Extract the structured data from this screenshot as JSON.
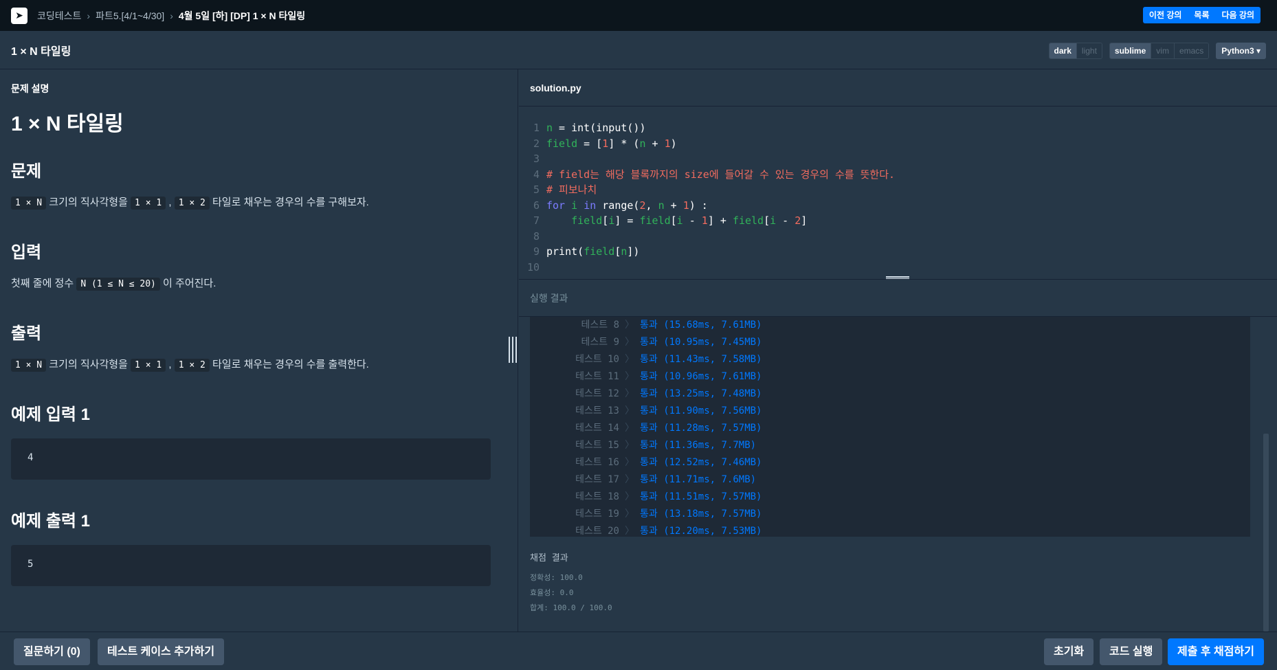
{
  "topbar": {
    "breadcrumb": [
      "코딩테스트",
      "파트5.[4/1~4/30]"
    ],
    "current": "4월 5일 [하] [DP] 1 × N 타일링",
    "nav": [
      "이전 강의",
      "목록",
      "다음 강의"
    ]
  },
  "subbar": {
    "title": "1 × N 타일링",
    "theme": [
      "dark",
      "light"
    ],
    "keymap": [
      "sublime",
      "vim",
      "emacs"
    ],
    "language": "Python3 ▾"
  },
  "problem": {
    "label": "문제 설명",
    "title": "1 × N 타일링",
    "sections": {
      "q_title": "문제",
      "q_code1": "1 × N",
      "q_text1": " 크기의 직사각형을 ",
      "q_code2": "1 × 1",
      "q_comma": " , ",
      "q_code3": "1 × 2",
      "q_text2": " 타일로 채우는 경우의 수를 구해보자.",
      "in_title": "입력",
      "in_text1": "첫째 줄에 정수 ",
      "in_code": "N (1 ≤ N ≤ 20)",
      "in_text2": " 이 주어진다.",
      "out_title": "출력",
      "out_code1": "1 × N",
      "out_text1": " 크기의 직사각형을 ",
      "out_code2": "1 × 1",
      "out_comma": " , ",
      "out_code3": "1 × 2",
      "out_text2": " 타일로 채우는 경우의 수를 출력한다.",
      "sin_title": "예제 입력 1",
      "sin_value": "4",
      "sout_title": "예제 출력 1",
      "sout_value": "5"
    }
  },
  "editor": {
    "filename": "solution.py",
    "lines": [
      {
        "n": "1",
        "segs": [
          [
            "n",
            "#31b35a"
          ],
          [
            " = int(input())",
            "#ffffff"
          ]
        ]
      },
      {
        "n": "2",
        "segs": [
          [
            "field",
            "#31b35a"
          ],
          [
            " = [",
            "#ffffff"
          ],
          [
            "1",
            "#f36c5f"
          ],
          [
            "] * (",
            "#ffffff"
          ],
          [
            "n",
            "#31b35a"
          ],
          [
            " + ",
            "#ffffff"
          ],
          [
            "1",
            "#f36c5f"
          ],
          [
            ")",
            "#ffffff"
          ]
        ]
      },
      {
        "n": "3",
        "segs": []
      },
      {
        "n": "4",
        "segs": [
          [
            "# ",
            "#f36c5f"
          ],
          [
            "field",
            "#f36c5f"
          ],
          [
            "는 해당 블록까지의 ",
            "#f36c5f"
          ],
          [
            "size",
            "#f36c5f"
          ],
          [
            "에 들어갈 수 있는 경우의 수를 뜻한다.",
            "#f36c5f"
          ]
        ]
      },
      {
        "n": "5",
        "segs": [
          [
            "# 피보나치",
            "#f36c5f"
          ]
        ]
      },
      {
        "n": "6",
        "segs": [
          [
            "for",
            "#7c7cff"
          ],
          [
            " ",
            "#ffffff"
          ],
          [
            "i",
            "#31b35a"
          ],
          [
            " ",
            "#ffffff"
          ],
          [
            "in",
            "#7c7cff"
          ],
          [
            " range(",
            "#ffffff"
          ],
          [
            "2",
            "#f36c5f"
          ],
          [
            ", ",
            "#ffffff"
          ],
          [
            "n",
            "#31b35a"
          ],
          [
            " + ",
            "#ffffff"
          ],
          [
            "1",
            "#f36c5f"
          ],
          [
            ") :",
            "#ffffff"
          ]
        ]
      },
      {
        "n": "7",
        "segs": [
          [
            "    field",
            "#31b35a"
          ],
          [
            "[",
            "#ffffff"
          ],
          [
            "i",
            "#31b35a"
          ],
          [
            "] = ",
            "#ffffff"
          ],
          [
            "field",
            "#31b35a"
          ],
          [
            "[",
            "#ffffff"
          ],
          [
            "i",
            "#31b35a"
          ],
          [
            " - ",
            "#ffffff"
          ],
          [
            "1",
            "#f36c5f"
          ],
          [
            "] + ",
            "#ffffff"
          ],
          [
            "field",
            "#31b35a"
          ],
          [
            "[",
            "#ffffff"
          ],
          [
            "i",
            "#31b35a"
          ],
          [
            " - ",
            "#ffffff"
          ],
          [
            "2",
            "#f36c5f"
          ],
          [
            "]",
            "#ffffff"
          ]
        ]
      },
      {
        "n": "8",
        "segs": []
      },
      {
        "n": "9",
        "segs": [
          [
            "print(",
            "#ffffff"
          ],
          [
            "field",
            "#31b35a"
          ],
          [
            "[",
            "#ffffff"
          ],
          [
            "n",
            "#31b35a"
          ],
          [
            "])",
            "#ffffff"
          ]
        ]
      },
      {
        "n": "10",
        "segs": []
      }
    ]
  },
  "results": {
    "title": "실행 결과",
    "tests": [
      {
        "name": "테스트 8",
        "result": "통과 (15.68ms, 7.61MB)"
      },
      {
        "name": "테스트 9",
        "result": "통과 (10.95ms, 7.45MB)"
      },
      {
        "name": "테스트 10",
        "result": "통과 (11.43ms, 7.58MB)"
      },
      {
        "name": "테스트 11",
        "result": "통과 (10.96ms, 7.61MB)"
      },
      {
        "name": "테스트 12",
        "result": "통과 (13.25ms, 7.48MB)"
      },
      {
        "name": "테스트 13",
        "result": "통과 (11.90ms, 7.56MB)"
      },
      {
        "name": "테스트 14",
        "result": "통과 (11.28ms, 7.57MB)"
      },
      {
        "name": "테스트 15",
        "result": "통과 (11.36ms, 7.7MB)"
      },
      {
        "name": "테스트 16",
        "result": "통과 (12.52ms, 7.46MB)"
      },
      {
        "name": "테스트 17",
        "result": "통과 (11.71ms, 7.6MB)"
      },
      {
        "name": "테스트 18",
        "result": "통과 (11.51ms, 7.57MB)"
      },
      {
        "name": "테스트 19",
        "result": "통과 (13.18ms, 7.57MB)"
      },
      {
        "name": "테스트 20",
        "result": "통과 (12.20ms, 7.53MB)"
      }
    ],
    "separator": "〉",
    "grade_title": "채점 결과",
    "accuracy": "정확성: 100.0",
    "efficiency": "효율성: 0.0",
    "total": "합계: 100.0 / 100.0"
  },
  "bottom": {
    "ask": "질문하기 (0)",
    "add_test": "테스트 케이스 추가하기",
    "reset": "초기화",
    "run": "코드 실행",
    "submit": "제출 후 채점하기"
  },
  "colors": {
    "accent": "#0078ff",
    "bg": "#263747",
    "topbar": "#0c151c"
  }
}
